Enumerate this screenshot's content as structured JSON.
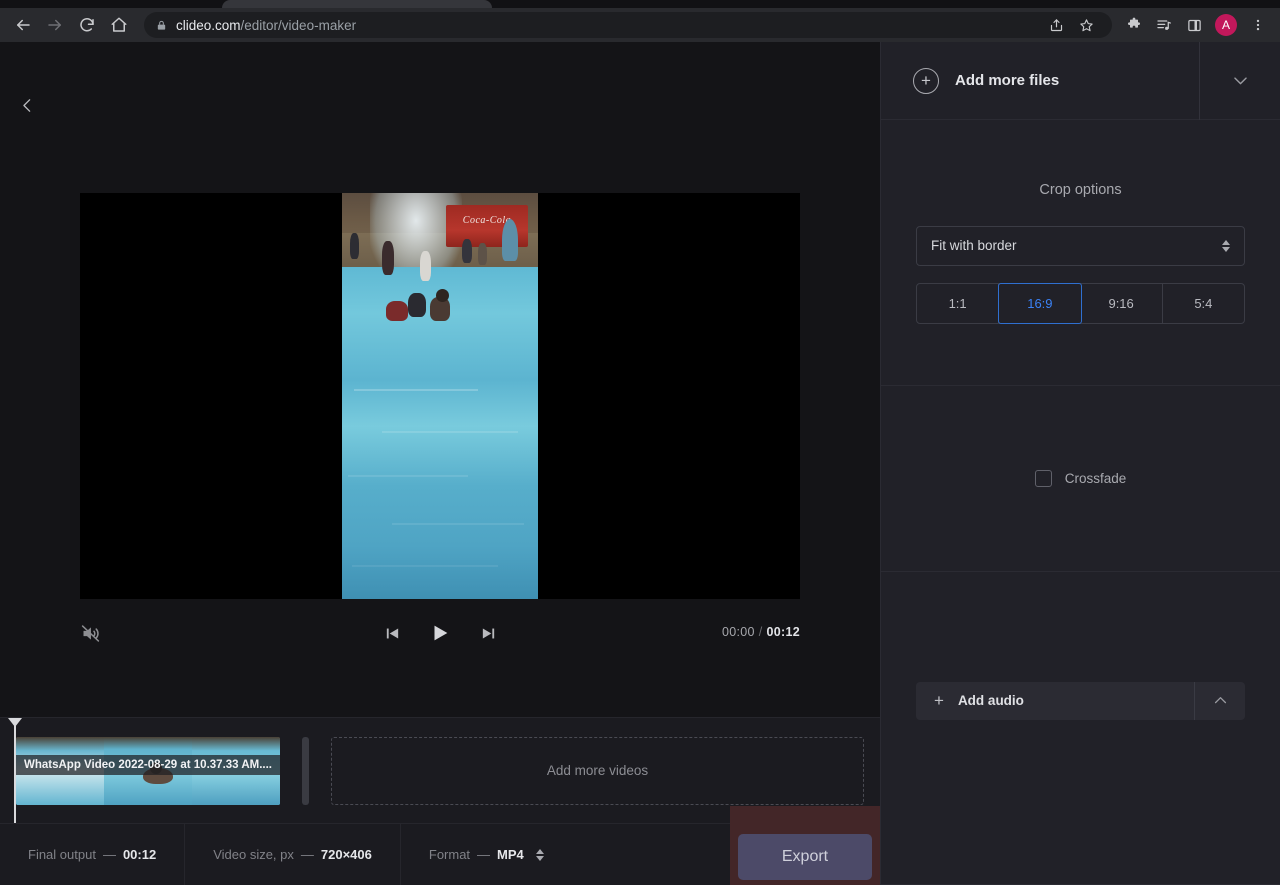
{
  "browser": {
    "url_domain": "clideo.com",
    "url_path": "/editor/video-maker",
    "avatar_letter": "A",
    "icons": {
      "back": "back-arrow-icon",
      "forward": "forward-arrow-icon",
      "reload": "reload-icon",
      "home": "home-icon",
      "lock": "lock-icon",
      "share": "share-icon",
      "bookmark": "star-icon",
      "extensions": "puzzle-piece-icon",
      "media": "media-playlist-icon",
      "sidepanel": "split-panel-icon",
      "menu": "three-dot-menu-icon"
    }
  },
  "editor": {
    "back_label": "Back",
    "player": {
      "mute_state": "muted",
      "current_time": "00:00",
      "separator": "/",
      "total_time": "00:12",
      "video_scene": "Water park pool with Coca-Cola sign"
    }
  },
  "timeline": {
    "clip_title": "WhatsApp Video 2022-08-29 at 10.37.33 AM....",
    "dropzone_label": "Add more videos"
  },
  "status": {
    "final_output_label": "Final output",
    "final_output_value": "00:12",
    "video_size_label": "Video size, px",
    "video_size_value": "720×406",
    "format_label": "Format",
    "format_value": "MP4",
    "dash": "—",
    "export_label": "Export"
  },
  "panel": {
    "add_files_label": "Add more files",
    "crop": {
      "title": "Crop options",
      "mode_value": "Fit with border",
      "ratios": [
        "1:1",
        "16:9",
        "9:16",
        "5:4"
      ],
      "active_ratio": "16:9"
    },
    "crossfade": {
      "label": "Crossfade",
      "checked": false
    },
    "audio": {
      "label": "Add audio"
    }
  },
  "colors": {
    "accent_blue": "#3b82f6",
    "panel_bg": "#212128",
    "canvas_bg": "#141417",
    "export_bg": "#4c4a68",
    "export_backdrop": "#432628",
    "avatar_bg": "#c2185b"
  }
}
